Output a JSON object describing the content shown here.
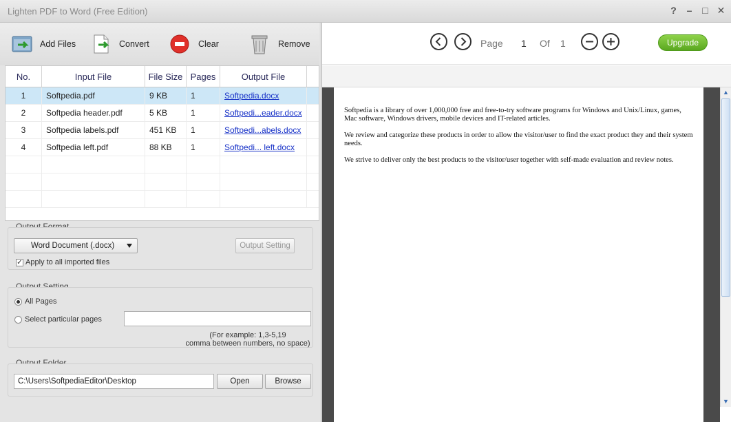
{
  "window": {
    "title": "Lighten PDF to Word (Free Edition)",
    "help": "?",
    "minimize": "–",
    "maximize": "□",
    "close": "✕"
  },
  "toolbar": {
    "add_files": "Add Files",
    "convert": "Convert",
    "clear": "Clear",
    "remove": "Remove"
  },
  "table": {
    "headers": [
      "No.",
      "Input File",
      "File Size",
      "Pages",
      "Output File"
    ],
    "rows": [
      {
        "no": "1",
        "input": "Softpedia.pdf",
        "size": "9 KB",
        "pages": "1",
        "output": "Softpedia.docx"
      },
      {
        "no": "2",
        "input": "Softpedia header.pdf",
        "size": "5 KB",
        "pages": "1",
        "output": "Softpedi...eader.docx"
      },
      {
        "no": "3",
        "input": "Softpedia labels.pdf",
        "size": "451 KB",
        "pages": "1",
        "output": "Softpedi...abels.docx"
      },
      {
        "no": "4",
        "input": "Softpedia left.pdf",
        "size": "88 KB",
        "pages": "1",
        "output": "Softpedi... left.docx"
      }
    ]
  },
  "output_format": {
    "label": "Output Format",
    "selected": "Word Document (.docx)",
    "setting_button": "Output Setting",
    "apply_all": "Apply to all imported files",
    "apply_all_checked": true
  },
  "output_setting": {
    "label": "Output Setting",
    "all_pages": "All Pages",
    "particular_pages": "Select particular pages",
    "pages_value": "",
    "hint_line1": "(For example: 1,3-5,19",
    "hint_line2": "comma between numbers, no space)"
  },
  "output_folder": {
    "label": "Output Folder",
    "path": "C:\\Users\\SoftpediaEditor\\Desktop",
    "open": "Open",
    "browse": "Browse"
  },
  "preview": {
    "page_label": "Page",
    "current_page": "1",
    "of_label": "Of",
    "total_pages": "1",
    "upgrade": "Upgrade",
    "paragraphs": [
      "Softpedia is a library of over 1,000,000 free and free-to-try software programs for Windows and Unix/Linux, games, Mac software, Windows drivers, mobile devices and IT-related articles.",
      "We review and categorize these products in order to allow the visitor/user to find the exact product they and their system needs.",
      "We strive to deliver only the best products to the visitor/user together with self-made evaluation and review notes."
    ]
  },
  "colors": {
    "accent_green": "#6cbd2f",
    "selection": "#cde7f7",
    "link": "#1a34c8"
  }
}
